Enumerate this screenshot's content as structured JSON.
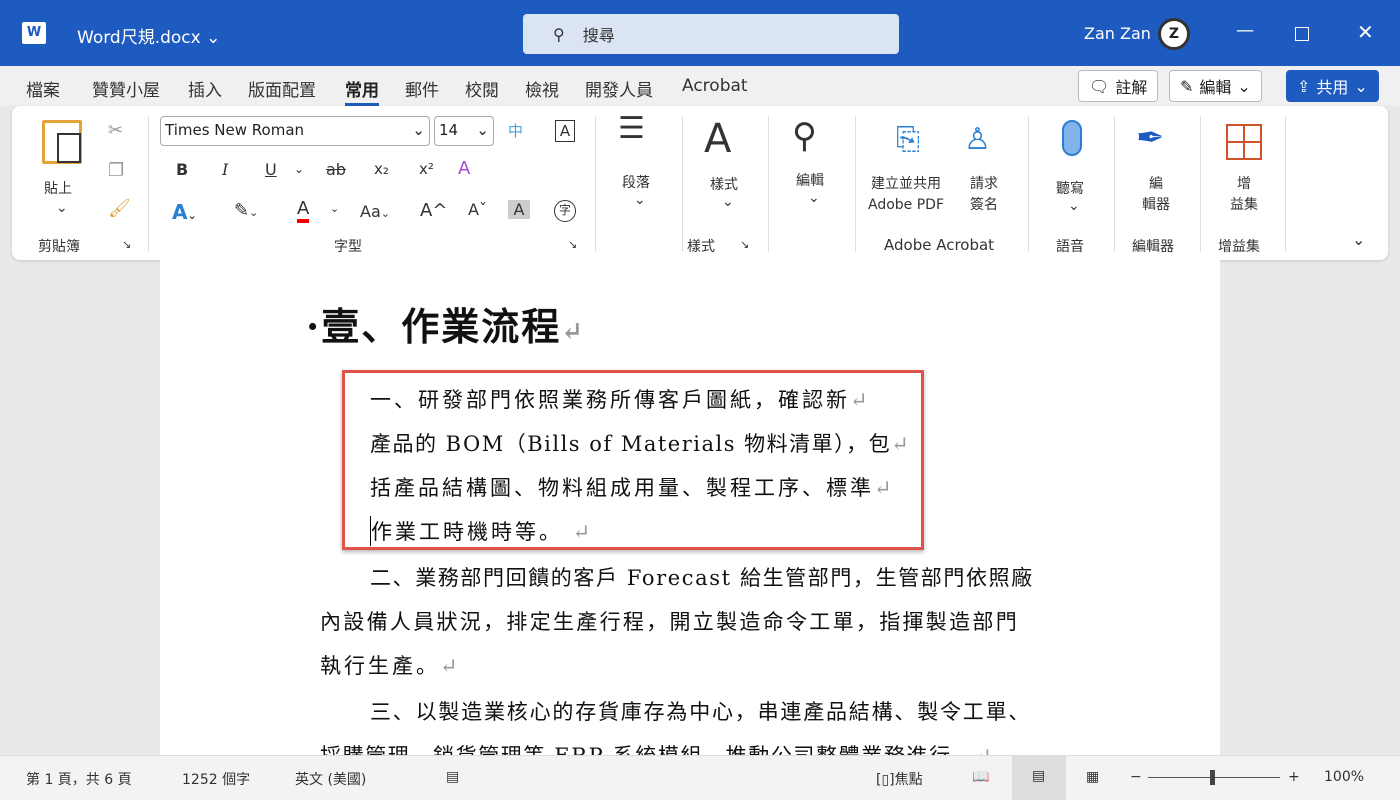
{
  "titlebar": {
    "filename": "Word尺規.docx",
    "search_placeholder": "搜尋",
    "user": "Zan Zan",
    "avatar_letter": "Z"
  },
  "tabs": [
    "檔案",
    "贊贊小屋",
    "插入",
    "版面配置",
    "常用",
    "郵件",
    "校閱",
    "檢視",
    "開發人員",
    "Acrobat"
  ],
  "active_tab": "常用",
  "header_buttons": {
    "comment": "註解",
    "edit": "編輯",
    "share": "共用"
  },
  "ribbon": {
    "clipboard": {
      "paste": "貼上",
      "group": "剪貼簿"
    },
    "font": {
      "name": "Times New Roman",
      "size": "14",
      "group": "字型",
      "bold": "B",
      "italic": "I",
      "underline": "U",
      "strike": "ab",
      "sub": "x₂",
      "sup": "x²",
      "case": "Aa",
      "grow": "A^",
      "shrink": "Aˇ",
      "shade": "A",
      "phonetic": "字",
      "border": "A"
    },
    "paragraph": {
      "label": "段落"
    },
    "styles": {
      "label": "樣式",
      "group": "樣式"
    },
    "editing": {
      "label": "編輯"
    },
    "acrobat": {
      "create": "建立並共用",
      "create2": "Adobe PDF",
      "sign": "請求",
      "sign2": "簽名",
      "group": "Adobe Acrobat"
    },
    "voice": {
      "label": "聽寫",
      "group": "語音"
    },
    "editor": {
      "label1": "編",
      "label2": "輯器",
      "group": "編輯器"
    },
    "addins": {
      "label1": "增",
      "label2": "益集",
      "group": "增益集"
    },
    "accent": "#1e5bc0"
  },
  "document": {
    "heading": "壹、作業流程",
    "lines": [
      "一、研發部門依照業務所傳客戶圖紙，確認新",
      "產品的 BOM（Bills of Materials  物料清單），包",
      "括產品結構圖、物料組成用量、製程工序、標準",
      "作業工時機時等。",
      "二、業務部門回饋的客戶 Forecast 給生管部門，生管部門依照廠",
      "內設備人員狀況，排定生產行程，開立製造命令工單，指揮製造部門",
      "執行生產。",
      "三、以製造業核心的存貨庫存為中心，串連產品結構、製令工單、",
      "採購管理、銷貨管理等 ERP 系統模組，推動公司整體業務進行。"
    ],
    "highlight_color": "#e0534a"
  },
  "status": {
    "page": "第 1 頁，共 6 頁",
    "words": "1252 個字",
    "language": "英文 (美國)",
    "focus": "焦點",
    "zoom": "100%",
    "zoom_percent": 100
  }
}
